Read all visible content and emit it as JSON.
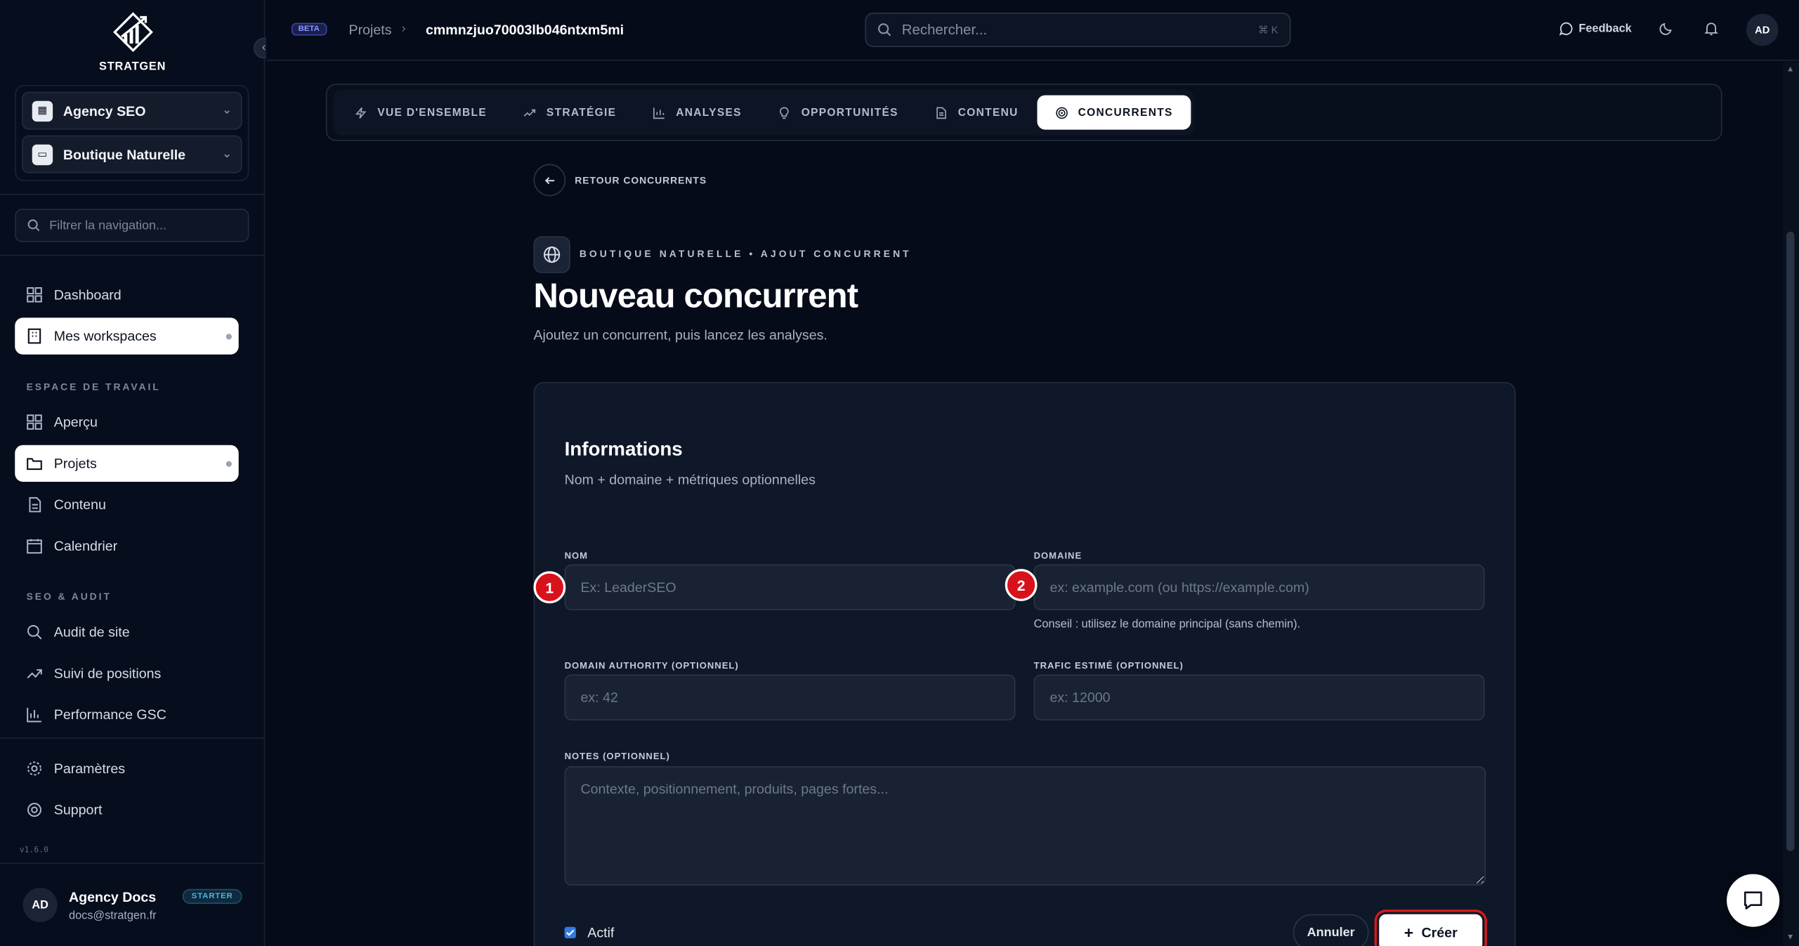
{
  "sidebar": {
    "logo_text": "STRATGEN",
    "workspace": {
      "agency": "Agency SEO",
      "project": "Boutique Naturelle"
    },
    "filter_placeholder": "Filtrer la navigation...",
    "nav_top": [
      {
        "label": "Dashboard",
        "icon": "grid-icon"
      },
      {
        "label": "Mes workspaces",
        "icon": "building-icon",
        "active": true
      }
    ],
    "section_workspace": "ESPACE DE TRAVAIL",
    "nav_workspace": [
      {
        "label": "Aperçu",
        "icon": "grid-icon"
      },
      {
        "label": "Projets",
        "icon": "folder-icon",
        "active": true
      },
      {
        "label": "Contenu",
        "icon": "document-icon"
      },
      {
        "label": "Calendrier",
        "icon": "calendar-icon"
      }
    ],
    "section_seo": "SEO & AUDIT",
    "nav_seo": [
      {
        "label": "Audit de site",
        "icon": "search-icon"
      },
      {
        "label": "Suivi de positions",
        "icon": "trend-icon"
      },
      {
        "label": "Performance GSC",
        "icon": "bar-chart-icon"
      }
    ],
    "nav_bottom": [
      {
        "label": "Paramètres",
        "icon": "gear-icon"
      },
      {
        "label": "Support",
        "icon": "lifebuoy-icon"
      }
    ],
    "version": "v1.6.0",
    "user": {
      "initials": "AD",
      "name": "Agency Docs",
      "email": "docs@stratgen.fr",
      "plan": "STARTER"
    }
  },
  "header": {
    "beta": "BETA",
    "breadcrumb": [
      "Projets",
      "cmmnzjuo70003lb046ntxm5mi"
    ],
    "search_placeholder": "Rechercher...",
    "search_shortcut": "⌘ K",
    "feedback": "Feedback",
    "avatar": "AD"
  },
  "tabs": [
    {
      "label": "VUE D'ENSEMBLE",
      "icon": "lightning-icon"
    },
    {
      "label": "STRATÉGIE",
      "icon": "trend-icon"
    },
    {
      "label": "ANALYSES",
      "icon": "bar-chart-icon"
    },
    {
      "label": "OPPORTUNITÉS",
      "icon": "lightbulb-icon"
    },
    {
      "label": "CONTENU",
      "icon": "document-icon"
    },
    {
      "label": "CONCURRENTS",
      "icon": "target-icon",
      "active": true
    }
  ],
  "page": {
    "back_label": "RETOUR CONCURRENTS",
    "kicker": "BOUTIQUE NATURELLE • AJOUT CONCURRENT",
    "title": "Nouveau concurrent",
    "subtitle": "Ajoutez un concurrent, puis lancez les analyses."
  },
  "form": {
    "title": "Informations",
    "subtitle": "Nom + domaine + métriques optionnelles",
    "name_label": "NOM",
    "name_placeholder": "Ex: LeaderSEO",
    "domain_label": "DOMAINE",
    "domain_placeholder": "ex: example.com (ou https://example.com)",
    "domain_hint": "Conseil : utilisez le domaine principal (sans chemin).",
    "da_label": "DOMAIN AUTHORITY (OPTIONNEL)",
    "da_placeholder": "ex: 42",
    "traffic_label": "TRAFIC ESTIMÉ (OPTIONNEL)",
    "traffic_placeholder": "ex: 12000",
    "notes_label": "NOTES (OPTIONNEL)",
    "notes_placeholder": "Contexte, positionnement, produits, pages fortes...",
    "active_label": "Actif",
    "active_checked": true,
    "cancel": "Annuler",
    "create": "Créer"
  },
  "markers": [
    "1",
    "2"
  ],
  "colors": {
    "background": "#050b18",
    "card": "#0f1828",
    "marker": "#d8121b",
    "highlight": "#e01818",
    "checkbox": "#2f7ae5"
  }
}
